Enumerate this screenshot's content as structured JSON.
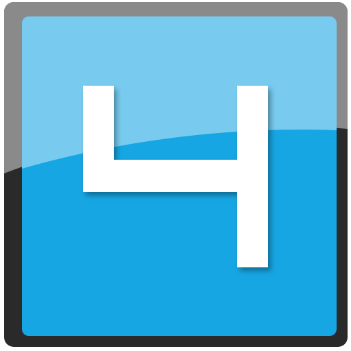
{
  "icon": {
    "glyph": "4",
    "icon_name": "number-four-app-icon"
  },
  "colors": {
    "frame_dark": "#2a2a2a",
    "frame_gloss": "#8a8a8a",
    "tile_blue": "#16a6e3",
    "tile_gloss": "#78cbef",
    "glyph": "#ffffff"
  }
}
